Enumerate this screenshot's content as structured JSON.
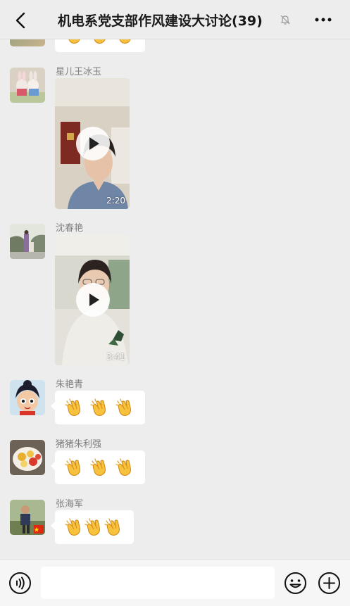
{
  "header": {
    "title": "机电系党支部作风建设大讨论(39)",
    "back_icon": "chevron-left-icon",
    "mute_icon": "bell-off-icon",
    "more_icon": "more-dots-icon"
  },
  "messages": [
    {
      "sender": "",
      "type": "emoji",
      "content": "clap-emoji x3"
    },
    {
      "sender": "星儿王冰玉",
      "type": "video",
      "duration": "2:20"
    },
    {
      "sender": "沈春艳",
      "type": "video",
      "duration": "3:41"
    },
    {
      "sender": "朱艳青",
      "type": "emoji",
      "content": "clap-emoji x3"
    },
    {
      "sender": "猪猪朱利强",
      "type": "emoji",
      "content": "clap-emoji x3"
    },
    {
      "sender": "张海军",
      "type": "emoji",
      "content": "clap-emoji x3"
    }
  ],
  "input_bar": {
    "voice_icon": "voice-icon",
    "input_value": "",
    "emoji_icon": "emoji-icon",
    "plus_icon": "plus-icon"
  },
  "colors": {
    "background": "#ededed",
    "bubble": "#ffffff",
    "sender_text": "#7f7f7f",
    "bottom_bar": "#f6f6f6"
  }
}
